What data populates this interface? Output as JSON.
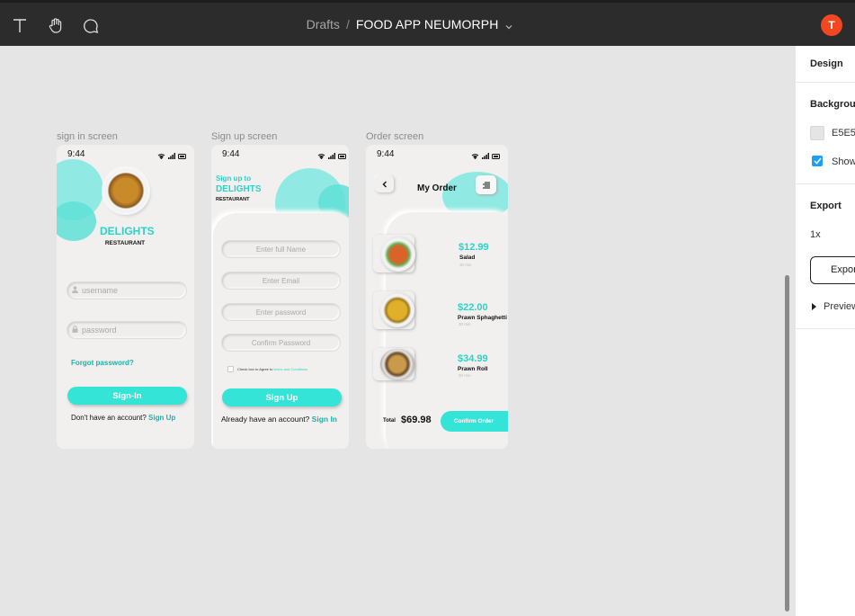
{
  "toolbar": {
    "tools": [
      "text-tool",
      "hand-tool",
      "comment-tool"
    ],
    "breadcrumb_parent": "Drafts",
    "breadcrumb_sep": "/",
    "file_name": "FOOD APP NEUMORPH",
    "avatar_initial": "T",
    "avatar_color": "#f24822"
  },
  "right_panel": {
    "tab": "Design",
    "background_heading": "Backgrou",
    "bg_value": "E5E5",
    "show_label": "Show",
    "export_heading": "Export",
    "export_scale": "1x",
    "export_button": "Expor",
    "preview_label": "Preview"
  },
  "frames": [
    {
      "label": "sign in screen",
      "time": "9:44",
      "brand": "DELIGHTS",
      "brand_sub": "RESTAURANT",
      "username_placeholder": "username",
      "password_placeholder": "password",
      "forgot": "Forgot password?",
      "button": "Sign-In",
      "footer_text": "Don't have an account?",
      "footer_link": "Sign Up"
    },
    {
      "label": "Sign up screen",
      "time": "9:44",
      "heading_1": "Sign up to",
      "heading_2": "DELIGHTS",
      "heading_sub": "RESTAURANT",
      "fields": [
        "Enter full Name",
        "Enter Email",
        "Enter password",
        "Confirm Password"
      ],
      "terms_prefix": "Check box to Agree to",
      "terms_link": "terms and Conditions",
      "button": "Sign Up",
      "footer_text": "Already have an account?",
      "footer_link": "Sign In"
    },
    {
      "label": "Order screen",
      "time": "9:44",
      "title": "My Order",
      "items": [
        {
          "price": "$12.99",
          "name": "Salad",
          "sub": "30 min"
        },
        {
          "price": "$22.00",
          "name": "Prawn Sphaghetti",
          "sub": "30 min"
        },
        {
          "price": "$34.99",
          "name": "Prawn Roll",
          "sub": "30 min"
        }
      ],
      "total_label": "Total",
      "total_value": "$69.98",
      "confirm_button": "Confirm Order"
    }
  ],
  "colors": {
    "accent": "#34e4d7",
    "canvas": "#e5e5e5",
    "toolbar": "#2c2c2c"
  }
}
